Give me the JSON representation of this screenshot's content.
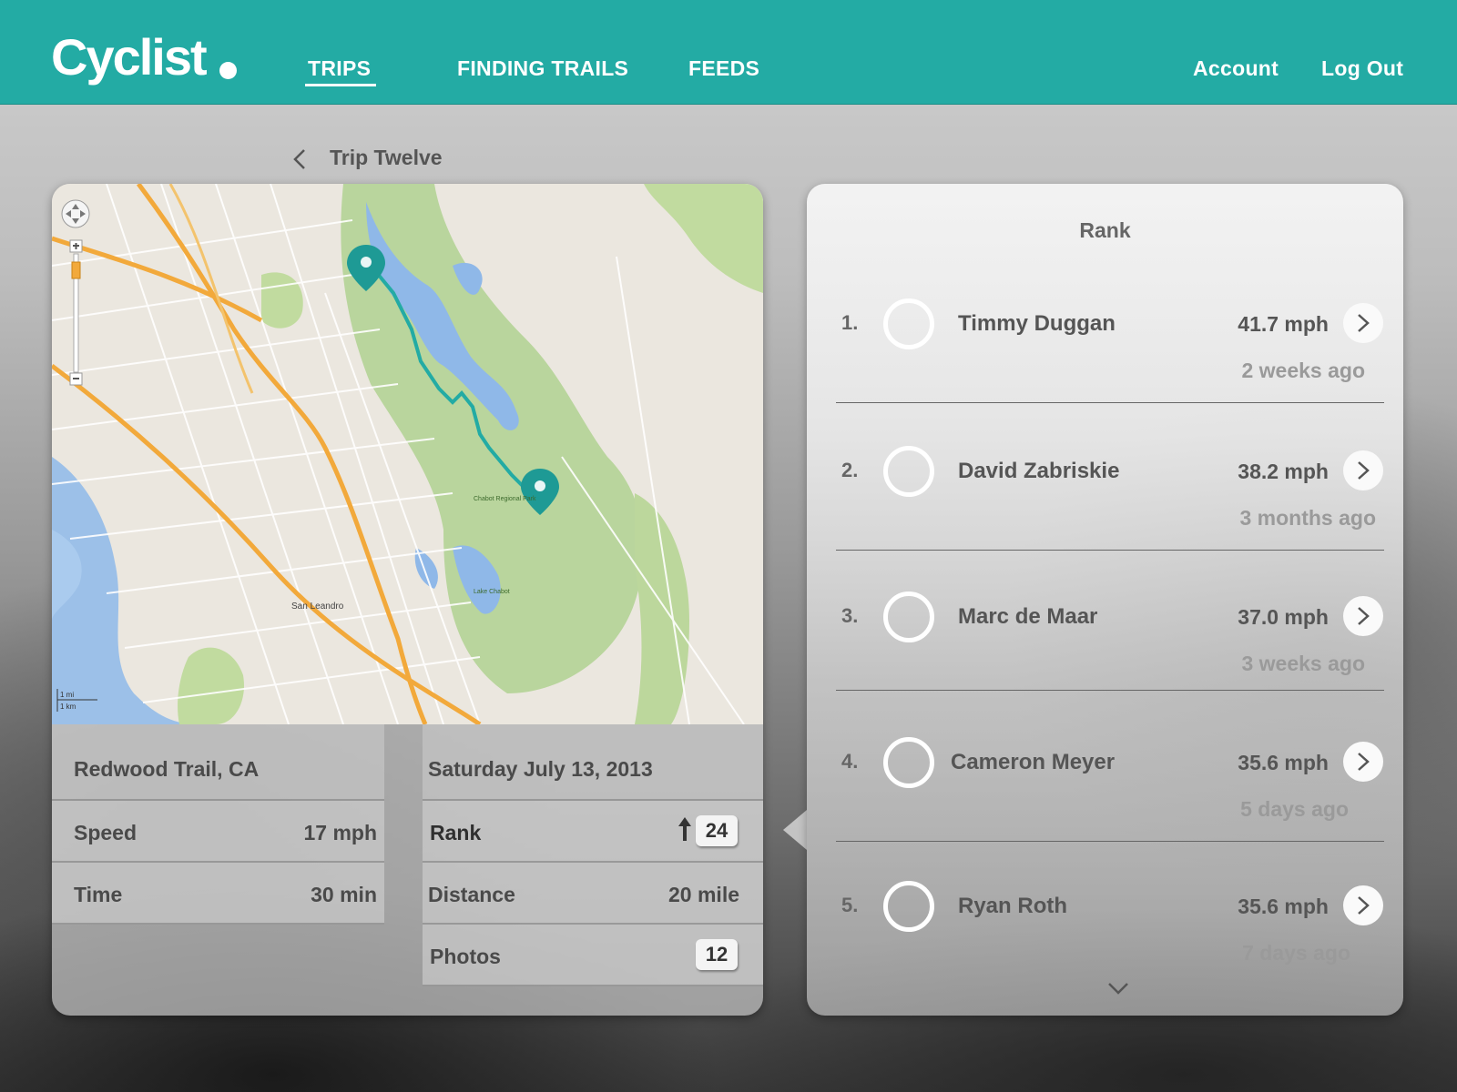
{
  "app": {
    "logo": "Cyclist",
    "nav": {
      "trips": "TRIPS",
      "finding_trails": "FINDING TRAILS",
      "feeds": "FEEDS",
      "account": "Account",
      "logout": "Log Out"
    },
    "accent_color": "#23aba4"
  },
  "breadcrumb": {
    "title": "Trip Twelve"
  },
  "map": {
    "labels": {
      "san_leandro": "San Leandro",
      "chabot": "Chabot Regional Park",
      "lake_chabot": "Lake Chabot",
      "scale_mi": "1 mi",
      "scale_km": "1 km"
    }
  },
  "trip": {
    "location": "Redwood Trail, CA",
    "date": "Saturday July 13, 2013",
    "speed_label": "Speed",
    "speed_value": "17 mph",
    "time_label": "Time",
    "time_value": "30 min",
    "rank_label": "Rank",
    "rank_value": "24",
    "distance_label": "Distance",
    "distance_value": "20 mile",
    "photos_label": "Photos",
    "photos_value": "12"
  },
  "rank_panel": {
    "title": "Rank",
    "entries": [
      {
        "num": "1.",
        "name": "Timmy Duggan",
        "speed": "41.7 mph",
        "when": "2 weeks ago"
      },
      {
        "num": "2.",
        "name": "David Zabriskie",
        "speed": "38.2 mph",
        "when": "3 months ago"
      },
      {
        "num": "3.",
        "name": "Marc de Maar",
        "speed": "37.0 mph",
        "when": "3 weeks ago"
      },
      {
        "num": "4.",
        "name": "Cameron Meyer",
        "speed": "35.6 mph",
        "when": "5 days ago"
      },
      {
        "num": "5.",
        "name": "Ryan Roth",
        "speed": "35.6 mph",
        "when": "7 days ago"
      }
    ]
  }
}
